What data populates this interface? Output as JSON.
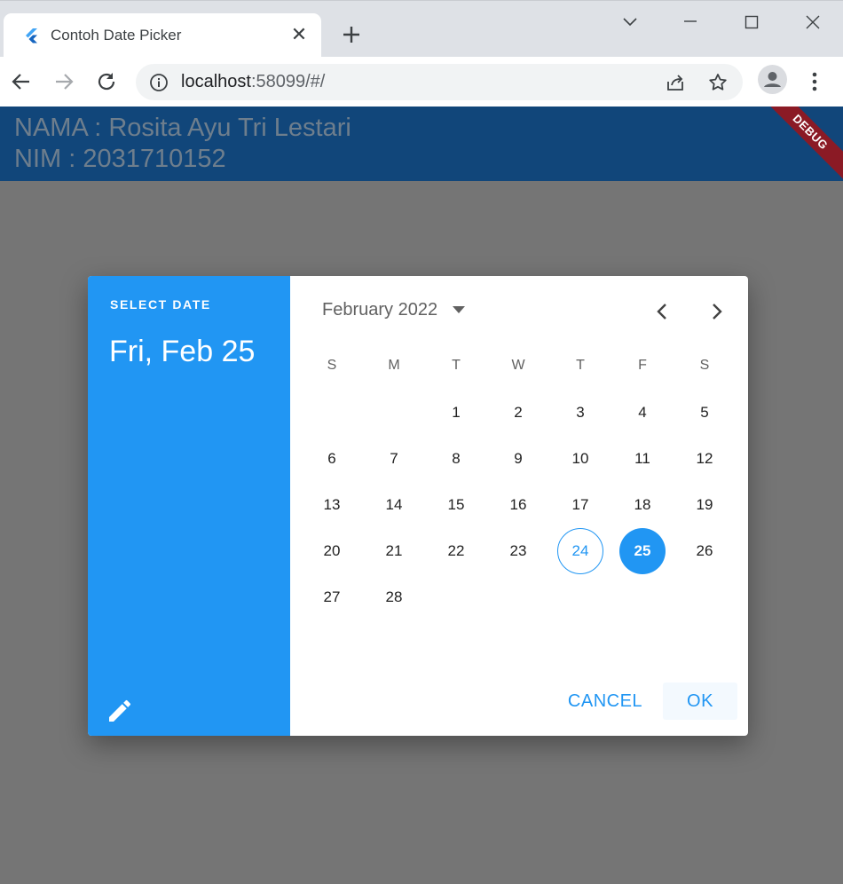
{
  "browser": {
    "tab_title": "Contoh Date Picker",
    "url_host": "localhost",
    "url_rest": ":58099/#/"
  },
  "appbar": {
    "line1": "NAMA : Rosita Ayu Tri Lestari",
    "line2": "NIM : 2031710152",
    "debug_label": "DEBUG"
  },
  "dialog": {
    "help_text": "SELECT DATE",
    "selected_date": "Fri, Feb 25",
    "month_year": "February 2022",
    "weekdays": [
      "S",
      "M",
      "T",
      "W",
      "T",
      "F",
      "S"
    ],
    "days": [
      "1",
      "2",
      "3",
      "4",
      "5",
      "6",
      "7",
      "8",
      "9",
      "10",
      "11",
      "12",
      "13",
      "14",
      "15",
      "16",
      "17",
      "18",
      "19",
      "20",
      "21",
      "22",
      "23",
      "24",
      "25",
      "26",
      "27",
      "28"
    ],
    "first_weekday_index": 2,
    "today": "24",
    "selected": "25",
    "cancel_label": "CANCEL",
    "ok_label": "OK"
  },
  "colors": {
    "primary": "#2196f3",
    "appbar": "#11467a",
    "scrim": "#757575",
    "debug": "#8b1a25"
  }
}
